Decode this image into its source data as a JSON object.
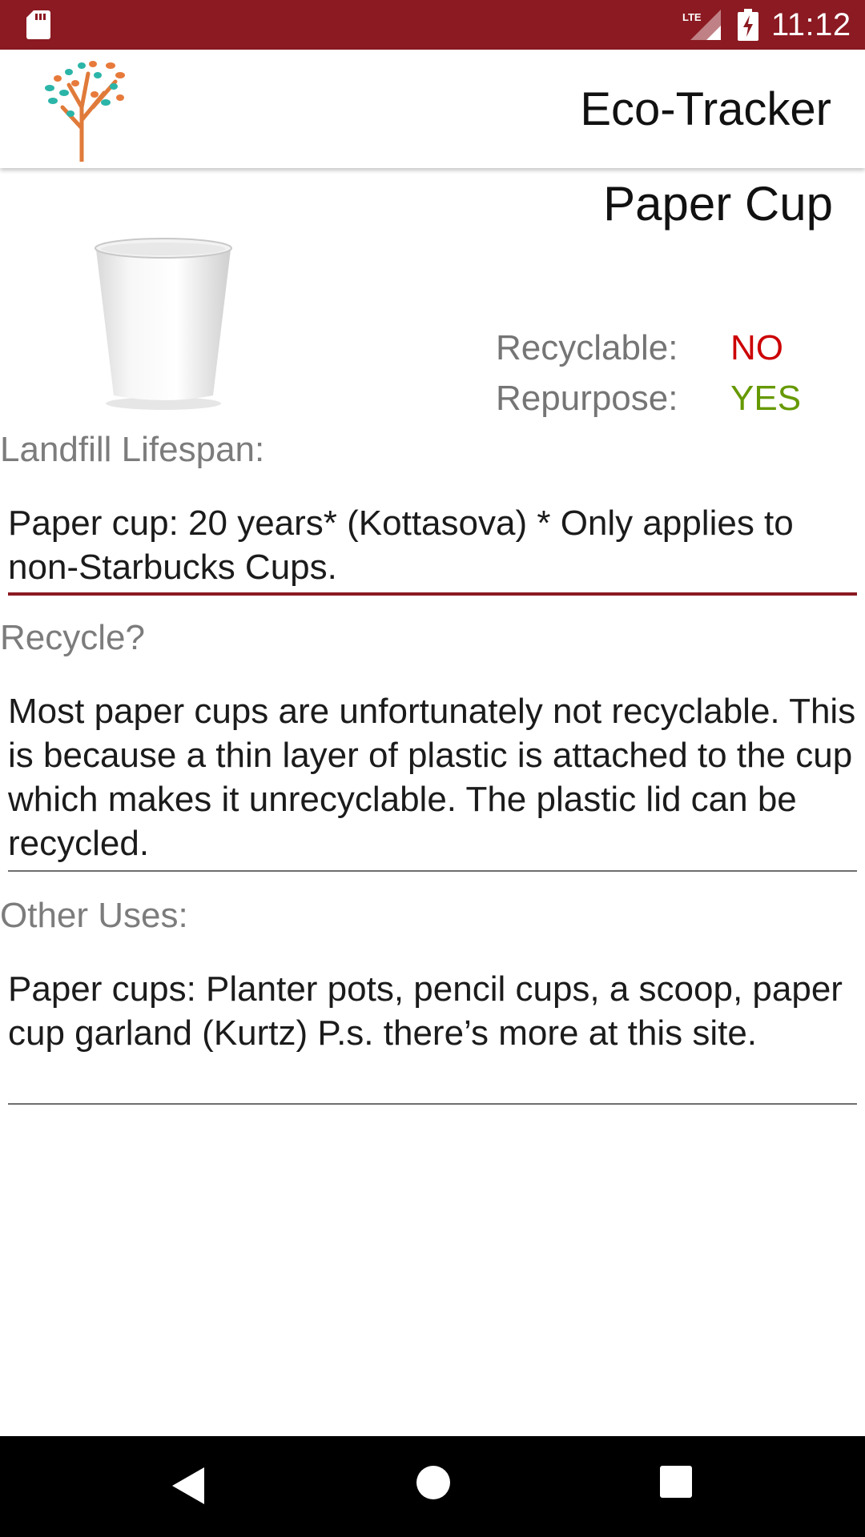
{
  "status_bar": {
    "network": "LTE",
    "time": "11:12"
  },
  "app_bar": {
    "title": "Eco-Tracker",
    "logo_icon": "tree-logo-icon"
  },
  "item": {
    "name": "Paper Cup",
    "image_icon": "paper-cup-image",
    "properties": [
      {
        "label": "Recyclable:",
        "value": "NO",
        "color": "#cc0000"
      },
      {
        "label": "Repurpose:",
        "value": "YES",
        "color": "#669900"
      }
    ]
  },
  "sections": [
    {
      "label": "Landfill Lifespan:",
      "text": "Paper cup: 20 years* (Kottasova)  * Only applies to non-Starbucks Cups."
    },
    {
      "label": "Recycle?",
      "text": "Most paper cups are unfortunately not recyclable.  This is because a thin layer of plastic is attached to the cup which makes it unrecyclable.  The plastic lid can be recycled."
    },
    {
      "label": "Other Uses:",
      "text": "Paper cups: Planter pots, pencil cups, a scoop, paper cup garland (Kurtz) P.s. there’s more at this site."
    }
  ],
  "colors": {
    "primary": "#8b1a22",
    "negative": "#cc0000",
    "positive": "#669900"
  },
  "nav_bar": {
    "back_icon": "back-triangle-icon",
    "home_icon": "home-circle-icon",
    "recents_icon": "recents-square-icon"
  }
}
